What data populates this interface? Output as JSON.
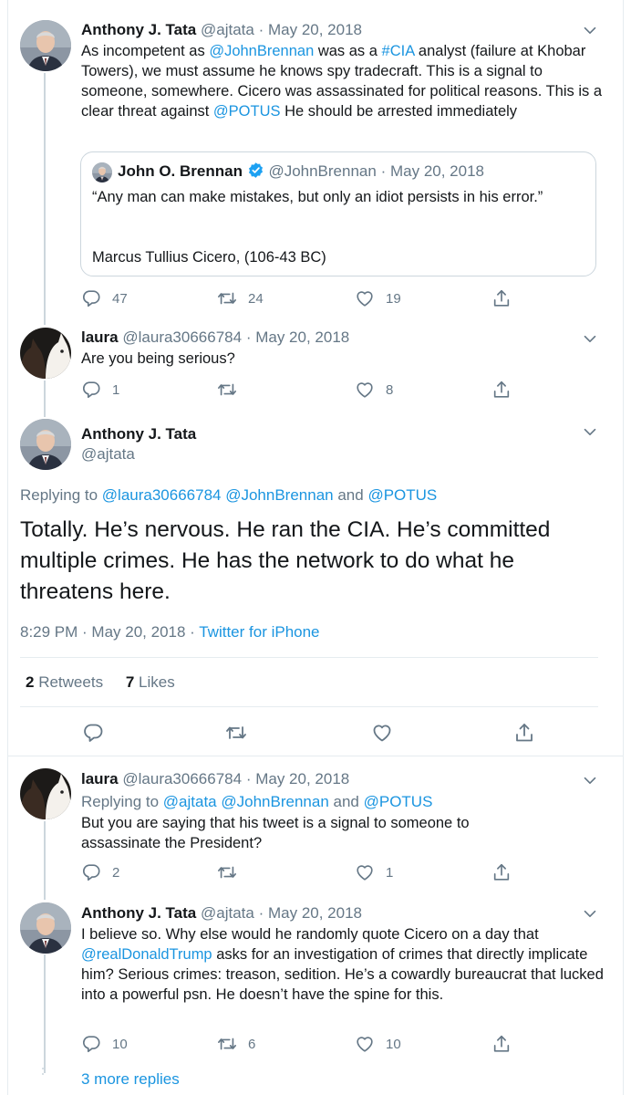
{
  "tweets": [
    {
      "name": "Anthony J. Tata",
      "handle": "@ajtata",
      "date": "May 20, 2018",
      "text_1": "As incompetent as ",
      "link_1": "@JohnBrennan",
      "text_2": " was as a ",
      "link_2": "#CIA",
      "text_3": " analyst (failure at Khobar Towers), we must assume he knows spy tradecraft. This is a signal to someone, somewhere. Cicero was assassinated for political reasons. This is a clear threat against ",
      "link_3": "@POTUS",
      "text_4": " He should be arrested immediately",
      "replies": "47",
      "retweets": "24",
      "likes": "19"
    },
    {
      "name": "laura",
      "handle": "@laura30666784",
      "date": "May 20, 2018",
      "text": "Are you being serious?",
      "replies": "1",
      "retweets": "",
      "likes": "8"
    }
  ],
  "quote": {
    "name": "John O. Brennan",
    "handle": "@JohnBrennan",
    "date": "May 20, 2018",
    "line_1": "“Any man can make mistakes, but only an idiot persists in his error.”",
    "line_2": "Marcus Tullius Cicero, (106-43 BC)",
    "verified_color": "#1da1f2"
  },
  "focused": {
    "name": "Anthony J. Tata",
    "handle": "@ajtata",
    "replying_prefix": "Replying to ",
    "replying_1": "@laura30666784",
    "replying_2": "@JohnBrennan",
    "replying_and": " and ",
    "replying_3": "@POTUS",
    "text": "Totally. He’s nervous. He ran the CIA. He’s committed multiple crimes. He has the network to do what he threatens here.",
    "time": "8:29 PM · May 20, 2018 · ",
    "source": "Twitter for iPhone",
    "retweets_count": "2",
    "retweets_label": "Retweets",
    "likes_count": "7",
    "likes_label": "Likes"
  },
  "replies": [
    {
      "name": "laura",
      "handle": "@laura30666784",
      "date": "May 20, 2018",
      "replying_prefix": "Replying to ",
      "replying_1": "@ajtata",
      "replying_2": "@JohnBrennan",
      "replying_and": " and ",
      "replying_3": "@POTUS",
      "text": "But you are saying that his tweet is a signal to someone to assassinate the President?",
      "replies": "2",
      "retweets": "",
      "likes": "1"
    },
    {
      "name": "Anthony J. Tata",
      "handle": "@ajtata",
      "date": "May 20, 2018",
      "text_1": "I believe so. Why else would he randomly quote Cicero on a day that ",
      "link_1": "@realDonaldTrump",
      "text_2": " asks for an investigation of crimes that directly implicate him? Serious crimes: treason, sedition. He’s a cowardly bureaucrat that lucked into a powerful psn. He doesn’t have the spine for this.",
      "replies": "10",
      "retweets": "6",
      "likes": "10"
    }
  ],
  "more_replies": "3 more replies",
  "colors": {
    "link": "#1b95e0",
    "muted": "#657786",
    "border": "#e6ecf0",
    "thread": "#ccd6dd"
  },
  "icons": [
    "reply-icon",
    "retweet-icon",
    "like-icon",
    "share-icon",
    "chevron-down-icon",
    "verified-badge-icon"
  ]
}
